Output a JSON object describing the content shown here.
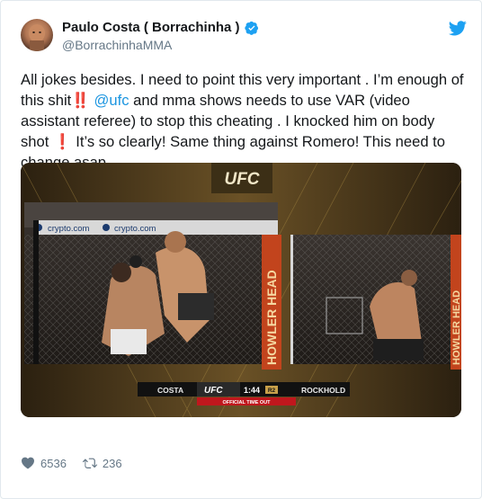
{
  "author": {
    "name": "Paulo Costa ( Borrachinha )",
    "handle": "@BorrachinhaMMA"
  },
  "tweet": {
    "text_before_link": "All jokes besides. I need to point this very important . I’m enough of this shit‼️ ",
    "mention": "@ufc",
    "text_after_link": " and mma shows needs to use VAR (video assistant referee) to stop this cheating . I knocked him on body shot ❗ It’s so clearly! Same thing against Romero! This need to change asap."
  },
  "media": {
    "top_logo": "UFC",
    "banner_left": "crypto.com",
    "banner_right": "crypto.com",
    "sponsor_vertical": "HOWLER HEAD",
    "scorebug": {
      "fighter_left": "COSTA",
      "logo": "UFC",
      "clock": "1:44",
      "round": "R2",
      "fighter_right": "ROCKHOLD",
      "notice": "OFFICIAL TIME OUT"
    }
  },
  "stats": {
    "likes": "6536",
    "retweets": "236"
  },
  "colors": {
    "link": "#1b95e0",
    "twitter_blue": "#1da1f2",
    "muted": "#657786"
  }
}
